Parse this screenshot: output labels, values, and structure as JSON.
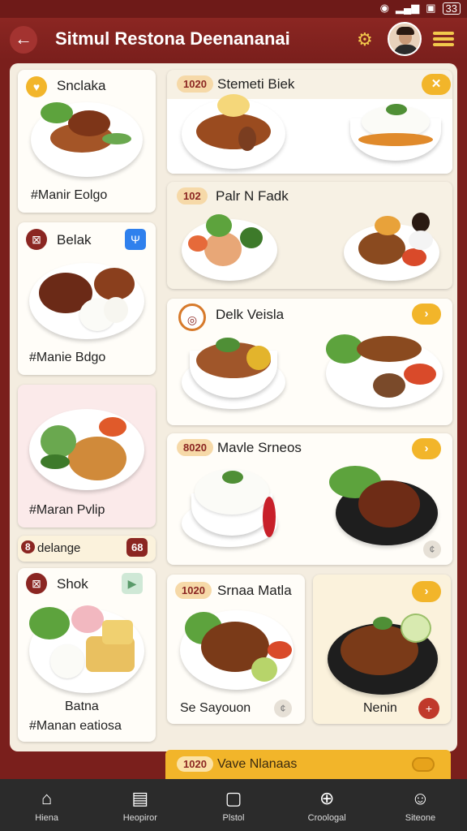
{
  "status_bar": {
    "battery": "33"
  },
  "header": {
    "title": "Sitmul Restona Deenananai"
  },
  "cards": {
    "c1": {
      "title": "Snclaka",
      "caption": "#Manir Eolgo"
    },
    "c2": {
      "badge": "1020",
      "title": "Stemeti Biek"
    },
    "c3": {
      "title": "Belak",
      "caption": "#Manie Bdgo"
    },
    "c4": {
      "badge": "102",
      "title": "Palr N Fadk"
    },
    "c5": {
      "caption": "#Maran Pvlip"
    },
    "c6": {
      "title": "Delk Veisla"
    },
    "c7": {
      "badge": "8",
      "title": "delange",
      "right_badge": "68"
    },
    "c8": {
      "badge": "8020",
      "title": "Mavle Srneos"
    },
    "c9": {
      "title": "Shok",
      "caption1": "Batna",
      "caption2": "#Manan eatiosa"
    },
    "c10": {
      "badge": "1020",
      "title": "Srnaa Matla",
      "caption": "Se Sayouon"
    },
    "c11": {
      "caption": "Nenin"
    }
  },
  "banner": {
    "badge": "1020",
    "label": "Vave Nlanaas"
  },
  "nav": [
    {
      "label": "Hiena",
      "icon": "home-icon"
    },
    {
      "label": "Heopiror",
      "icon": "menu-book-icon"
    },
    {
      "label": "Plstol",
      "icon": "tablet-icon"
    },
    {
      "label": "Croologal",
      "icon": "globe-icon"
    },
    {
      "label": "Siteone",
      "icon": "person-icon"
    }
  ],
  "colors": {
    "primary": "#8b2622",
    "accent": "#f2b52a",
    "nav": "#2b2b2b",
    "panel": "#f4ede0"
  }
}
